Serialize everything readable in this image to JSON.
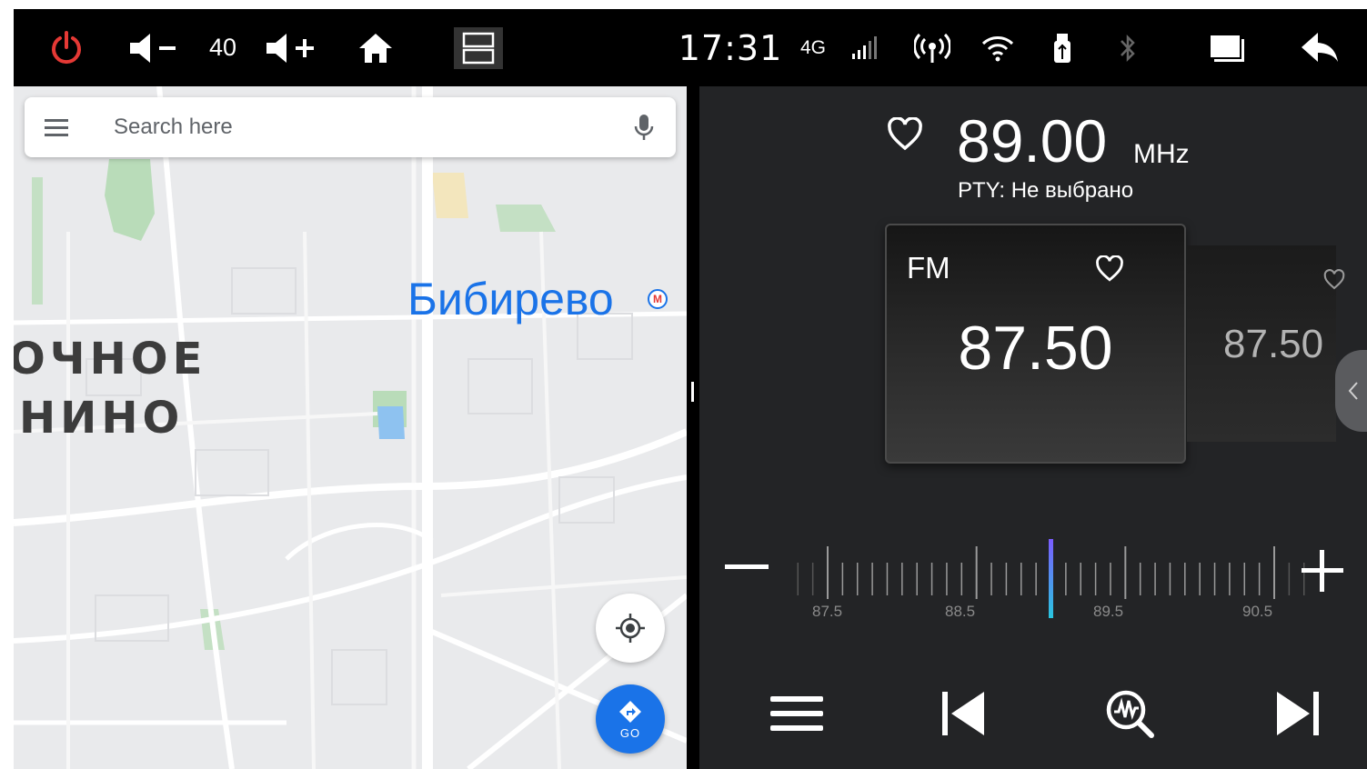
{
  "statusbar": {
    "power_icon": "power-icon",
    "volume_down_icon": "volume-down-icon",
    "volume_value": "40",
    "volume_up_icon": "volume-up-icon",
    "home_icon": "home-icon",
    "split_icon": "split-screen-icon",
    "clock": "17:31",
    "network": "4G",
    "signal_icon": "cell-signal-icon",
    "hotspot_icon": "hotspot-icon",
    "wifi_icon": "wifi-icon",
    "usb_icon": "usb-icon",
    "bluetooth_icon": "bluetooth-icon",
    "window_icon": "window-icon",
    "back_icon": "back-icon",
    "power_color": "#e53935"
  },
  "map": {
    "search_placeholder": "Search here",
    "place_label": "Бибирево",
    "metro_badge": "М",
    "district_line1": "ОЧНОЕ",
    "district_line2": "НИНО",
    "go_label": "GO",
    "accent": "#1a73e8"
  },
  "radio": {
    "frequency": "89.00",
    "unit": "MHz",
    "pty": "PTY: Не выбрано",
    "card_band": "FM",
    "card_frequency": "87.50",
    "side_frequency": "87.50",
    "scale_labels": [
      "87.5",
      "88.5",
      "89.5",
      "90.5"
    ],
    "tuned_value": 89.0,
    "scale_min": 87.5,
    "scale_max": 90.5
  }
}
